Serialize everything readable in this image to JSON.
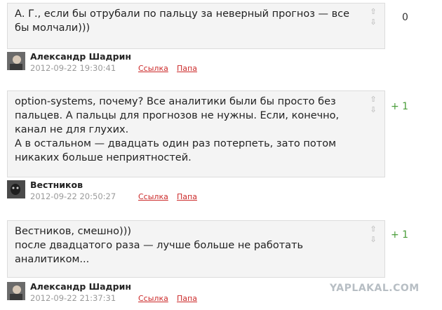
{
  "comments": [
    {
      "text": "А. Г., если бы отрубали по пальцу за неверный прогноз — все бы молчали)))",
      "score": "0",
      "author": "Александр Шадрин",
      "timestamp": "2012-09-22 19:30:41",
      "link_label": "Ссылка",
      "parent_label": "Папа"
    },
    {
      "text": "option-systems, почему? Все аналитики были бы просто без пальцев. А пальцы для прогнозов не нужны. Если, конечно, канал не для глухих.\nА в остальном — двадцать один раз потерпеть, зато потом никаких больше неприятностей.",
      "score": "+ 1",
      "author": "Вестников",
      "timestamp": "2012-09-22 20:50:27",
      "link_label": "Ссылка",
      "parent_label": "Папа"
    },
    {
      "text": "Вестников, смешно)))\nпосле двадцатого раза — лучше больше не работать аналитиком...",
      "score": "+ 1",
      "author": "Александр Шадрин",
      "timestamp": "2012-09-22 21:37:31",
      "link_label": "Ссылка",
      "parent_label": "Папа"
    }
  ],
  "icons": {
    "vote_up": "⇧",
    "vote_down": "⇩"
  },
  "watermark": "YAPLAKAL.COM",
  "colors": {
    "positive_score": "#4a9d3a",
    "link": "#cc2a2a",
    "bubble_bg": "#f4f4f4"
  }
}
